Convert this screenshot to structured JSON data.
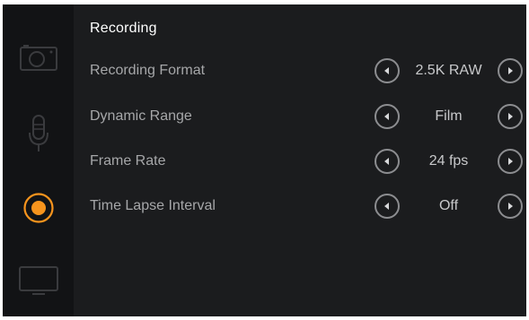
{
  "header": {
    "title": "Recording"
  },
  "sidebar": {
    "items": [
      {
        "icon": "camera-icon",
        "active": false
      },
      {
        "icon": "microphone-icon",
        "active": false
      },
      {
        "icon": "record-icon",
        "active": true
      },
      {
        "icon": "monitor-icon",
        "active": false
      }
    ]
  },
  "colors": {
    "accent": "#f7941d",
    "background": "#1b1c1e",
    "sidebar": "#121315",
    "label": "#a6a7a9",
    "value": "#c8c9cb"
  },
  "settings": [
    {
      "label": "Recording Format",
      "value": "2.5K RAW"
    },
    {
      "label": "Dynamic Range",
      "value": "Film"
    },
    {
      "label": "Frame Rate",
      "value": "24 fps"
    },
    {
      "label": "Time Lapse Interval",
      "value": "Off"
    }
  ]
}
